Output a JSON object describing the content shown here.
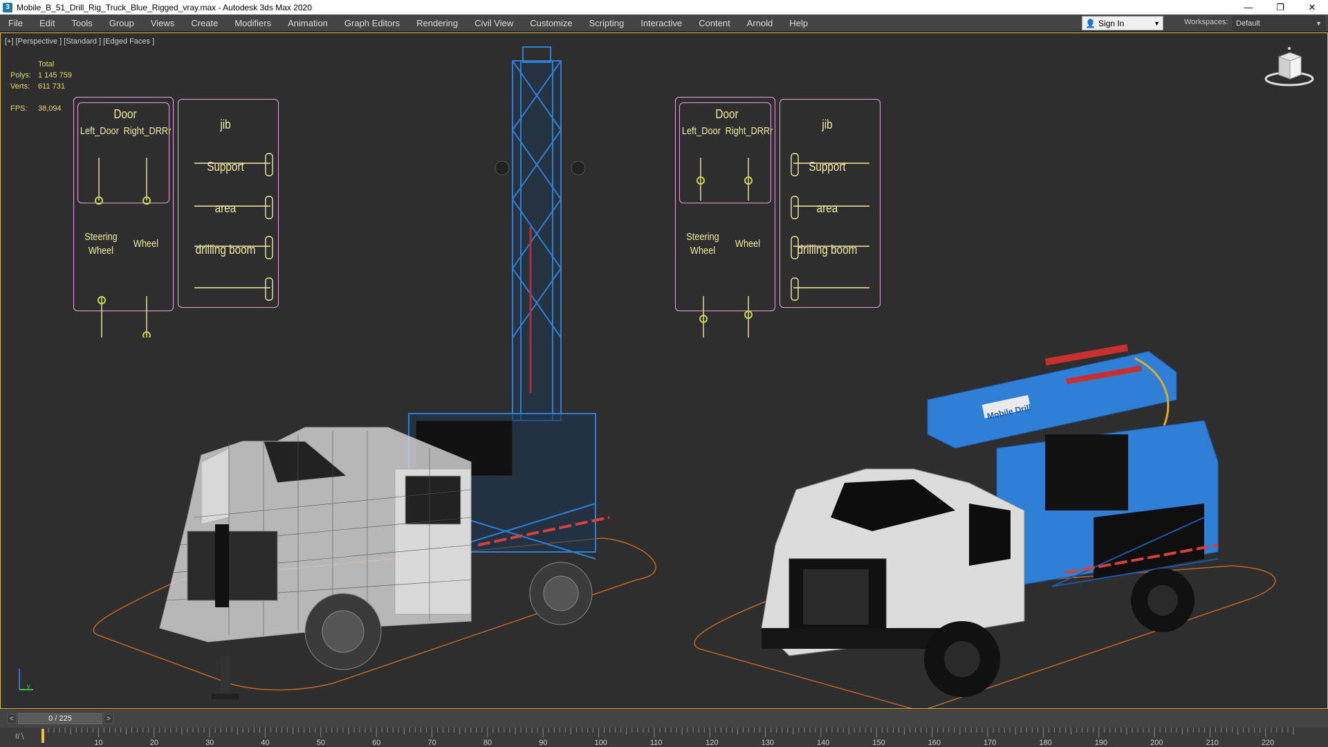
{
  "window": {
    "title": "Mobile_B_51_Drill_Rig_Truck_Blue_Rigged_vray.max - Autodesk 3ds Max 2020",
    "app_icon": "3ds-max-icon",
    "controls": [
      "minimize-icon",
      "restore-icon",
      "close-icon"
    ]
  },
  "menu": {
    "items": [
      "File",
      "Edit",
      "Tools",
      "Group",
      "Views",
      "Create",
      "Modifiers",
      "Animation",
      "Graph Editors",
      "Rendering",
      "Civil View",
      "Customize",
      "Scripting",
      "Interactive",
      "Content",
      "Arnold",
      "Help"
    ],
    "signin_label": "Sign In",
    "workspaces_label": "Workspaces:",
    "workspaces_value": "Default"
  },
  "viewport": {
    "label": "[+] [Perspective ] [Standard ] [Edged Faces ]",
    "stats": {
      "header": "Total",
      "polys_label": "Polys:",
      "polys_value": "1 145 759",
      "verts_label": "Verts:",
      "verts_value": "611 731",
      "fps_label": "FPS:",
      "fps_value": "38,094"
    }
  },
  "controls_panels": {
    "door": "Door",
    "left_door": "Left_Door",
    "right_door": "Right_DRRr",
    "steering_wheel_1": "Steering",
    "steering_wheel_2": "Wheel",
    "wheel": "Wheel",
    "jib": "jib",
    "support": "Support",
    "area": "area",
    "drilling_boom": "drilling boom"
  },
  "models": {
    "logo_text": "Mobile Drill"
  },
  "timeline": {
    "position": "0 / 225",
    "current_frame": 0,
    "total_frames": 225,
    "ticks": [
      "10",
      "20",
      "30",
      "40",
      "50",
      "60",
      "70",
      "80",
      "90",
      "100",
      "110",
      "120",
      "130",
      "140",
      "150",
      "160",
      "170",
      "180",
      "190",
      "200",
      "210",
      "220"
    ]
  },
  "colors": {
    "panel_border": "#e5a7e0",
    "panel_text": "#f1eca0",
    "slider_knob": "#c8d84a",
    "rig_blue": "#2f7fd6",
    "viewport_border": "#d8b84a",
    "grid_orange": "#c0662a"
  }
}
